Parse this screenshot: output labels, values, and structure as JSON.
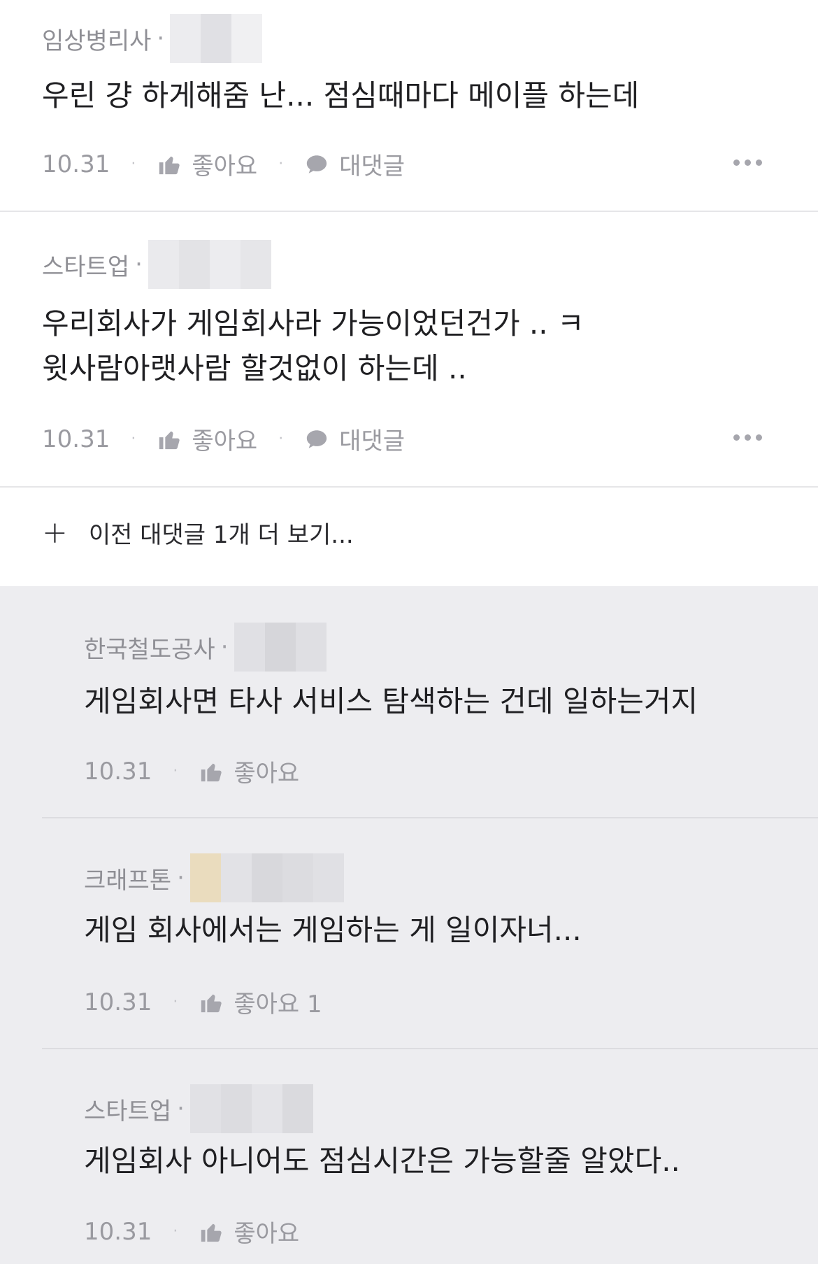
{
  "comments": [
    {
      "company": "임상병리사",
      "blur_colors": [
        "#e4e4e8",
        "#dcdcdf",
        "#ececef"
      ],
      "lines": [
        "우린 걍 하게해줌 난... 점심때마다 메이플 하는데"
      ],
      "date": "10.31",
      "like_label": "좋아요",
      "reply_label": "대댓글"
    },
    {
      "company": "스타트업",
      "blur_colors": [
        "#eaeaed",
        "#e3e3e6",
        "#ececef",
        "#e6e6e9"
      ],
      "lines": [
        "우리회사가 게임회사라 가능이었던건가 .. ㅋ",
        "윗사람아랫사람 할것없이 하는데 .."
      ],
      "date": "10.31",
      "like_label": "좋아요",
      "reply_label": "대댓글"
    }
  ],
  "expand": {
    "label": "이전 대댓글 1개 더 보기..."
  },
  "replies": [
    {
      "company": "한국철도공사",
      "blur_colors": [
        "#e0e0e4",
        "#d6d6da",
        "#dfdfe3"
      ],
      "text": "게임회사면 타사 서비스 탐색하는 건데 일하는거지",
      "date": "10.31",
      "like_label": "좋아요"
    },
    {
      "company": "크래프톤",
      "blur_colors": [
        "#eadcbe",
        "#e2e2e6",
        "#d8d8dc",
        "#dcdce0",
        "#e0e0e4"
      ],
      "text": "게임 회사에서는 게임하는 게 일이자너...",
      "date": "10.31",
      "like_label": "좋아요 1"
    },
    {
      "company": "스타트업",
      "blur_colors": [
        "#e1e1e5",
        "#dcdce0",
        "#e4e4e8",
        "#dadade"
      ],
      "text": "게임회사 아니어도 점심시간은 가능할줄 알았다..",
      "date": "10.31",
      "like_label": "좋아요"
    }
  ]
}
